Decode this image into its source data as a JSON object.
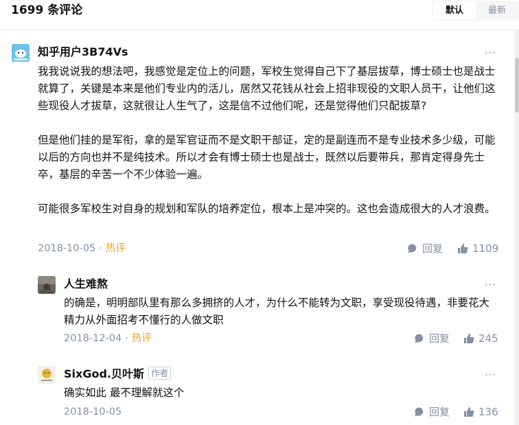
{
  "header": {
    "count": "1699 条评论",
    "sort_default": "默认",
    "sort_latest": "最新"
  },
  "comments": [
    {
      "author": "知乎用户3B74Vs",
      "paragraphs": [
        "我我说说我的想法吧，我感觉是定位上的问题，军校生觉得自己下了基层拔草，博士硕士也是战士就算了，关键是本来是他们专业内的活儿，居然又花钱从社会上招非现役的文职人员干，让他们这些现役人才拔草，这就很让人生气了，这是信不过他们呢，还是觉得他们只配拔草?",
        "但是他们挂的是军衔，拿的是军官证而不是文职干部证，定的是副连而不是专业技术多少级，可能以后的方向也并不是纯技术。所以才会有博士硕士也是战士，既然以后要带兵，那肯定得身先士卒，基层的辛苦一个不少体验一遍。",
        "可能很多军校生对自身的规划和军队的培养定位，根本上是冲突的。这也会造成很大的人才浪费。"
      ],
      "date": "2018-10-05",
      "separator": "·",
      "tag": "热评",
      "reply_label": "回复",
      "likes": "1109"
    },
    {
      "author": "人生难熬",
      "paragraphs": [
        "的确是，明明部队里有那么多拥挤的人才，为什么不能转为文职，享受现役待遇，非要花大精力从外面招考不懂行的人做文职"
      ],
      "date": "2018-12-04",
      "separator": "·",
      "tag": "热评",
      "reply_label": "回复",
      "likes": "245"
    },
    {
      "author": "SixGod.贝叶斯",
      "author_badge": "作者",
      "paragraphs": [
        "确实如此 最不理解就这个"
      ],
      "date": "2018-10-05",
      "reply_label": "回复",
      "likes": "136"
    }
  ],
  "more_glyph": "···",
  "colors": {
    "hot": "#f1a02a",
    "meta": "#8590a6",
    "text": "#121212"
  }
}
